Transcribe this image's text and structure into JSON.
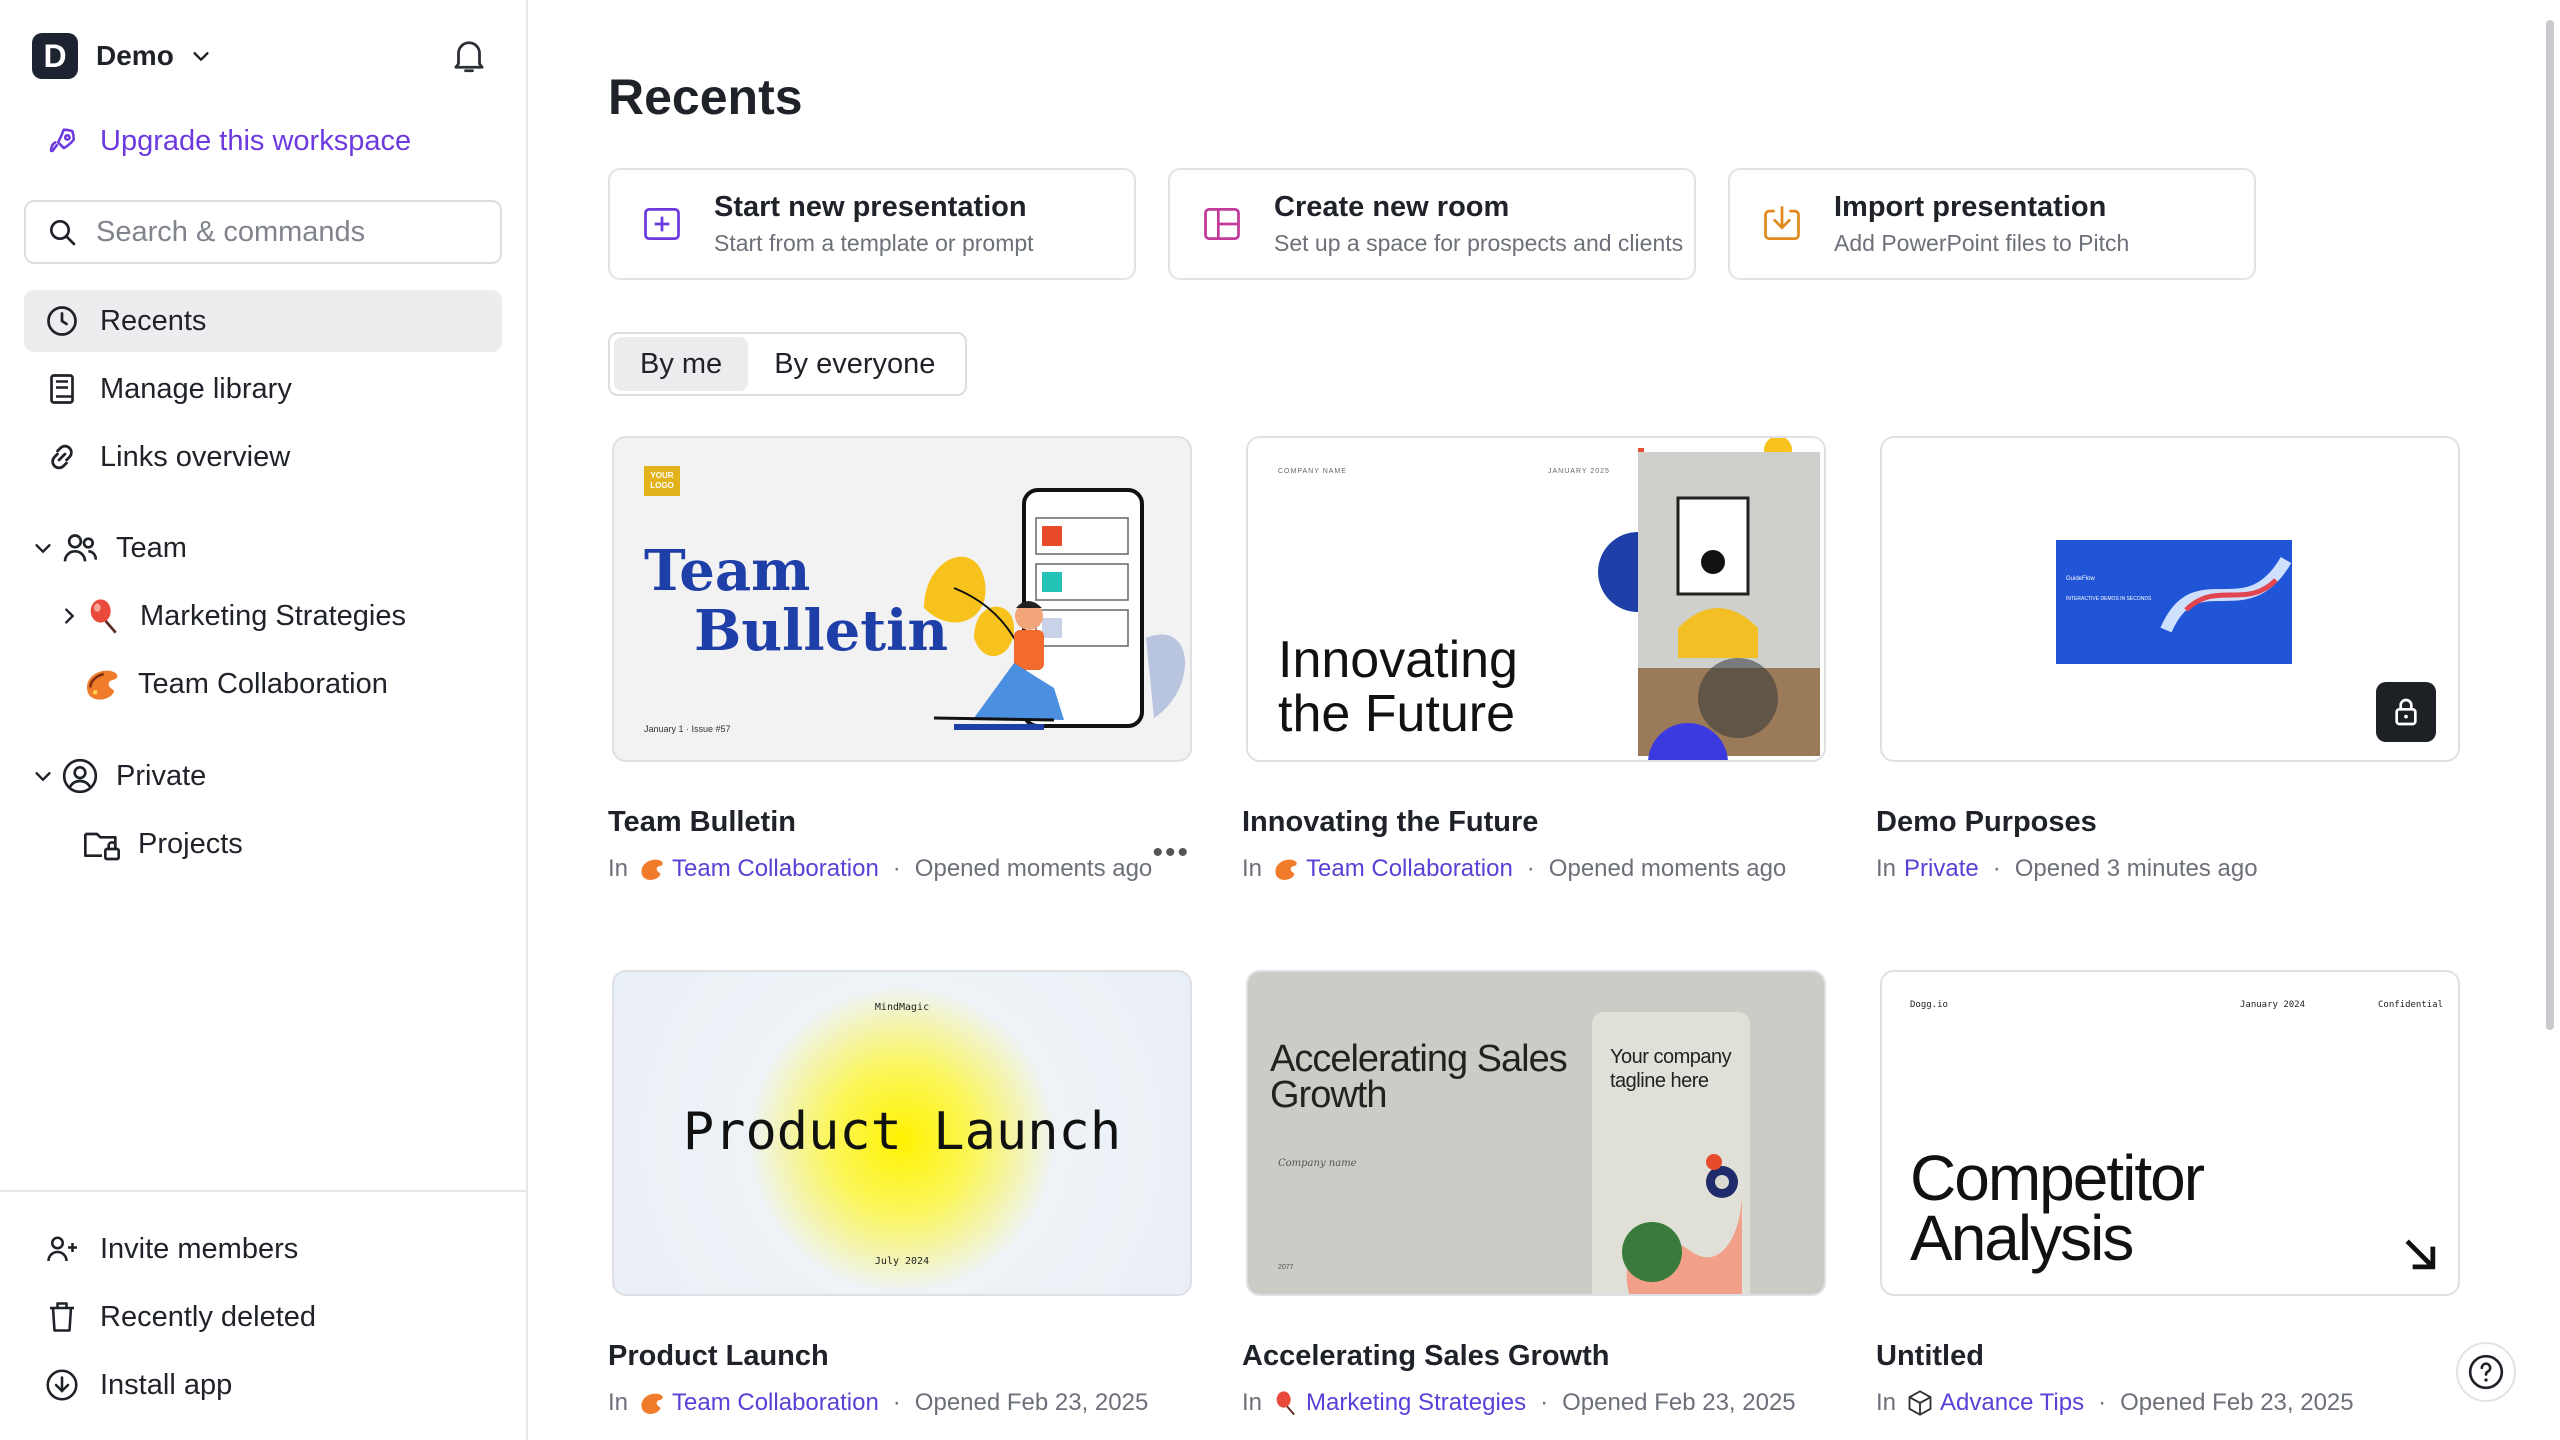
{
  "workspace": {
    "initial": "D",
    "name": "Demo"
  },
  "upgrade_label": "Upgrade this workspace",
  "search": {
    "placeholder": "Search & commands"
  },
  "nav": {
    "recents": "Recents",
    "manage_library": "Manage library",
    "links_overview": "Links overview"
  },
  "tree": {
    "team": "Team",
    "marketing": "Marketing Strategies",
    "team_collab": "Team Collaboration",
    "private": "Private",
    "projects": "Projects"
  },
  "bottom": {
    "invite": "Invite members",
    "deleted": "Recently deleted",
    "install": "Install app"
  },
  "main": {
    "title": "Recents",
    "actions": [
      {
        "title": "Start new presentation",
        "subtitle": "Start from a template or prompt"
      },
      {
        "title": "Create new room",
        "subtitle": "Set up a space for prospects and clients"
      },
      {
        "title": "Import presentation",
        "subtitle": "Add PowerPoint files to Pitch"
      }
    ],
    "filter": {
      "by_me": "By me",
      "by_everyone": "By everyone"
    },
    "in_label": "In",
    "cards": [
      {
        "title": "Team Bulletin",
        "folder": "Team Collaboration",
        "opened": "Opened moments ago",
        "thumb": {
          "logo": "YOUR LOGO",
          "line1": "Team",
          "line2": "Bulletin",
          "footer": "January 1 · Issue #57"
        }
      },
      {
        "title": "Innovating the Future",
        "folder": "Team Collaboration",
        "opened": "Opened moments ago",
        "thumb": {
          "company": "COMPANY NAME",
          "date": "JANUARY 2025",
          "line1": "Innovating",
          "line2": "the Future"
        }
      },
      {
        "title": "Demo Purposes",
        "folder": "Private",
        "opened": "Opened 3 minutes ago",
        "thumb": {
          "brand": "GuideFlow",
          "tag": "INTERACTIVE DEMOS IN SECONDS"
        }
      },
      {
        "title": "Product Launch",
        "folder": "Team Collaboration",
        "opened": "Opened Feb 23, 2025",
        "thumb": {
          "top": "MindMagic",
          "main": "Product Launch",
          "bottom": "July 2024"
        }
      },
      {
        "title": "Accelerating Sales Growth",
        "folder": "Marketing Strategies",
        "opened": "Opened Feb 23, 2025",
        "thumb": {
          "line1": "Accelerating Sales",
          "line2": "Growth",
          "company": "Company name",
          "tagline1": "Your company",
          "tagline2": "tagline here",
          "year": "2077"
        }
      },
      {
        "title": "Untitled",
        "folder": "Advance Tips",
        "opened": "Opened Feb 23, 2025",
        "thumb": {
          "left": "Dogg.io",
          "mid": "January 2024",
          "right": "Confidential",
          "line1": "Competitor",
          "line2": "Analysis"
        }
      }
    ]
  },
  "colors": {
    "accent": "#6d3ae0",
    "link": "#5b3fd6",
    "brand_dark": "#1d2330"
  }
}
